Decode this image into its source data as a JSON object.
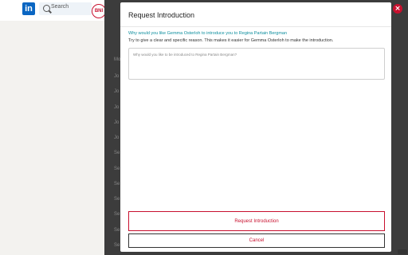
{
  "background": {
    "search_placeholder": "Search",
    "linkedin_logo": "in",
    "bni_logo": "BNI",
    "list_rows": [
      {
        "label": "Jo"
      },
      {
        "label": "Jo"
      },
      {
        "label": "Jo"
      },
      {
        "label": "Jo"
      },
      {
        "label": "Jo"
      },
      {
        "label": "Jo"
      },
      {
        "label": "Se"
      },
      {
        "label": "Se"
      },
      {
        "label": "Se"
      },
      {
        "label": "Se"
      },
      {
        "label": "Se"
      },
      {
        "label": "Se"
      },
      {
        "label": "Se"
      }
    ],
    "list_header": "Mor"
  },
  "modal": {
    "title": "Request Introduction",
    "question": "Why would you like Gemma Osterloh to introduce you to Regina Partain Bergman",
    "helper": "Try to give a clear and specific reason. This makes it easier for Gemma Osterloh to make the introduction.",
    "input_placeholder": "Why would you like to be introduced to Regina Partain Bergman?",
    "input_value": "",
    "primary_button": "Request Introduction",
    "secondary_button": "Cancel",
    "close_label": "×"
  },
  "colors": {
    "accent": "#c8102e",
    "teal": "#0d8e9e"
  }
}
